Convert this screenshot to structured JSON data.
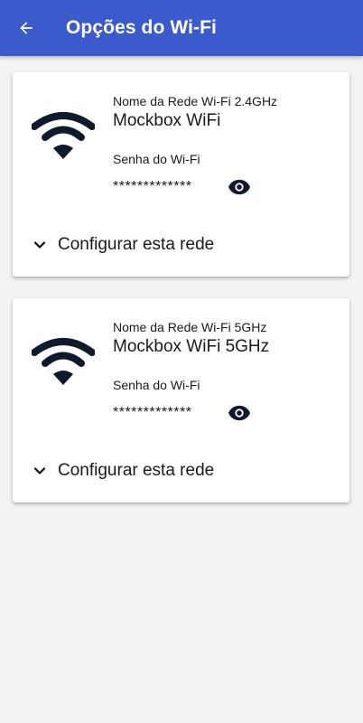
{
  "appbar": {
    "title": "Opções do Wi-Fi",
    "back_icon": "arrow-back-icon",
    "color": "#3b5bcc"
  },
  "networks": [
    {
      "network_label": "Nome da Rede Wi-Fi 2.4GHz",
      "network_name": "Mockbox WiFi",
      "password_label": "Senha do Wi-Fi",
      "password_masked": "*************",
      "configure_label": "Configurar esta rede"
    },
    {
      "network_label": "Nome da Rede Wi-Fi 5GHz",
      "network_name": "Mockbox WiFi 5GHz",
      "password_label": "Senha do Wi-Fi",
      "password_masked": "*************",
      "configure_label": "Configurar esta rede"
    }
  ],
  "icons": {
    "wifi": "wifi-icon",
    "eye": "eye-icon",
    "chevron": "chevron-down-icon"
  },
  "colors": {
    "icon_dark": "#0f1b2d",
    "background": "#f3f3f3",
    "card": "#ffffff"
  }
}
